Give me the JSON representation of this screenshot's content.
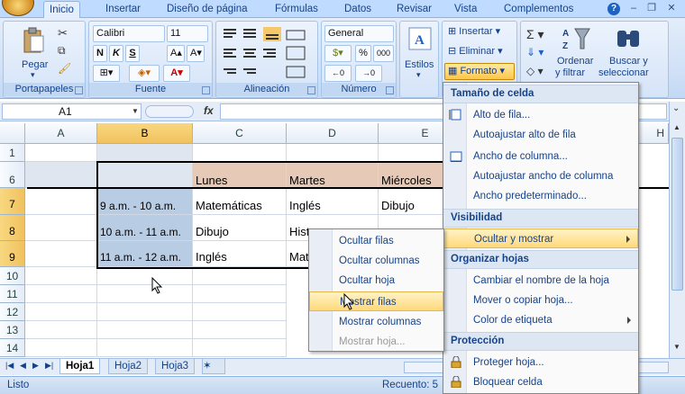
{
  "tabs": [
    "Inicio",
    "Insertar",
    "Diseño de página",
    "Fórmulas",
    "Datos",
    "Revisar",
    "Vista",
    "Complementos"
  ],
  "ribbon": {
    "clipboard": {
      "paste": "Pegar",
      "label": "Portapapeles"
    },
    "font": {
      "name": "Calibri",
      "size": "11",
      "bold": "N",
      "italic": "K",
      "underline": "S",
      "label": "Fuente"
    },
    "alignment": {
      "label": "Alineación"
    },
    "number": {
      "format": "General",
      "label": "Número",
      "percent": "%",
      "thousands": "000"
    },
    "styles": {
      "label": "Estilos"
    },
    "cells": {
      "insert": "Insertar",
      "delete": "Eliminar",
      "format": "Formato"
    },
    "editing": {
      "sort": "Ordenar",
      "sort2": "y filtrar",
      "find": "Buscar y",
      "find2": "seleccionar"
    }
  },
  "formula_bar": {
    "name_box": "A1",
    "fx": "fx",
    "formula": ""
  },
  "columns": [
    "A",
    "B",
    "C",
    "D",
    "E",
    "H"
  ],
  "rows": [
    "1",
    "6",
    "7",
    "8",
    "9",
    "10",
    "11",
    "12",
    "13",
    "14"
  ],
  "cells": {
    "c6": "Lunes",
    "d6": "Martes",
    "e6": "Miércoles",
    "b7": "9 a.m. - 10 a.m.",
    "c7": "Matemáticas",
    "d7": "Inglés",
    "e7": "Dibujo",
    "b8": "10 a.m. - 11 a.m.",
    "c8": "Dibujo",
    "d8": "Hist",
    "b9": "11 a.m. - 12 a.m.",
    "c9": "Inglés",
    "d9": "Mat"
  },
  "format_menu": {
    "sec_size": "Tamaño de celda",
    "row_height": "Alto de fila...",
    "autofit_row": "Autoajustar alto de fila",
    "col_width": "Ancho de columna...",
    "autofit_col": "Autoajustar ancho de columna",
    "default_width": "Ancho predeterminado...",
    "sec_visibility": "Visibilidad",
    "hide_show": "Ocultar y mostrar",
    "sec_organize": "Organizar hojas",
    "rename": "Cambiar el nombre de la hoja",
    "move_copy": "Mover o copiar hoja...",
    "tab_color": "Color de etiqueta",
    "sec_protect": "Protección",
    "protect": "Proteger hoja...",
    "lock": "Bloquear celda"
  },
  "submenu": {
    "hide_rows": "Ocultar filas",
    "hide_cols": "Ocultar columnas",
    "hide_sheet": "Ocultar hoja",
    "show_rows": "Mostrar filas",
    "show_cols": "Mostrar columnas",
    "show_sheet": "Mostrar hoja..."
  },
  "sheets": [
    "Hoja1",
    "Hoja2",
    "Hoja3"
  ],
  "status": {
    "ready": "Listo",
    "count": "Recuento: 5"
  }
}
